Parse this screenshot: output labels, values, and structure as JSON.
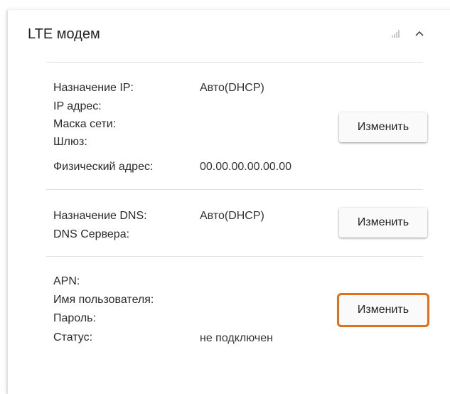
{
  "card": {
    "title": "LTE модем",
    "icons": [
      "signal-icon",
      "chevron-up-icon"
    ]
  },
  "ip_section": {
    "rows": [
      {
        "label": "Назначение IP:",
        "value": "Авто(DHCP)"
      },
      {
        "label": "IP адрес:",
        "value": ""
      },
      {
        "label": "Маска сети:",
        "value": ""
      },
      {
        "label": "Шлюз:",
        "value": ""
      },
      {
        "label": "Физический адрес:",
        "value": "00.00.00.00.00.00"
      }
    ],
    "button_label": "Изменить"
  },
  "dns_section": {
    "rows": [
      {
        "label": "Назначение DNS:",
        "value": "Авто(DHCP)"
      },
      {
        "label": "DNS Сервера:",
        "value": ""
      }
    ],
    "button_label": "Изменить"
  },
  "apn_section": {
    "rows": [
      {
        "label": "APN:",
        "value": ""
      },
      {
        "label": "Имя пользователя:",
        "value": ""
      },
      {
        "label": "Пароль:",
        "value": ""
      },
      {
        "label": "Статус:",
        "value": "не подключен"
      }
    ],
    "button_label": "Изменить",
    "button_highlight_color": "#e0701a"
  }
}
